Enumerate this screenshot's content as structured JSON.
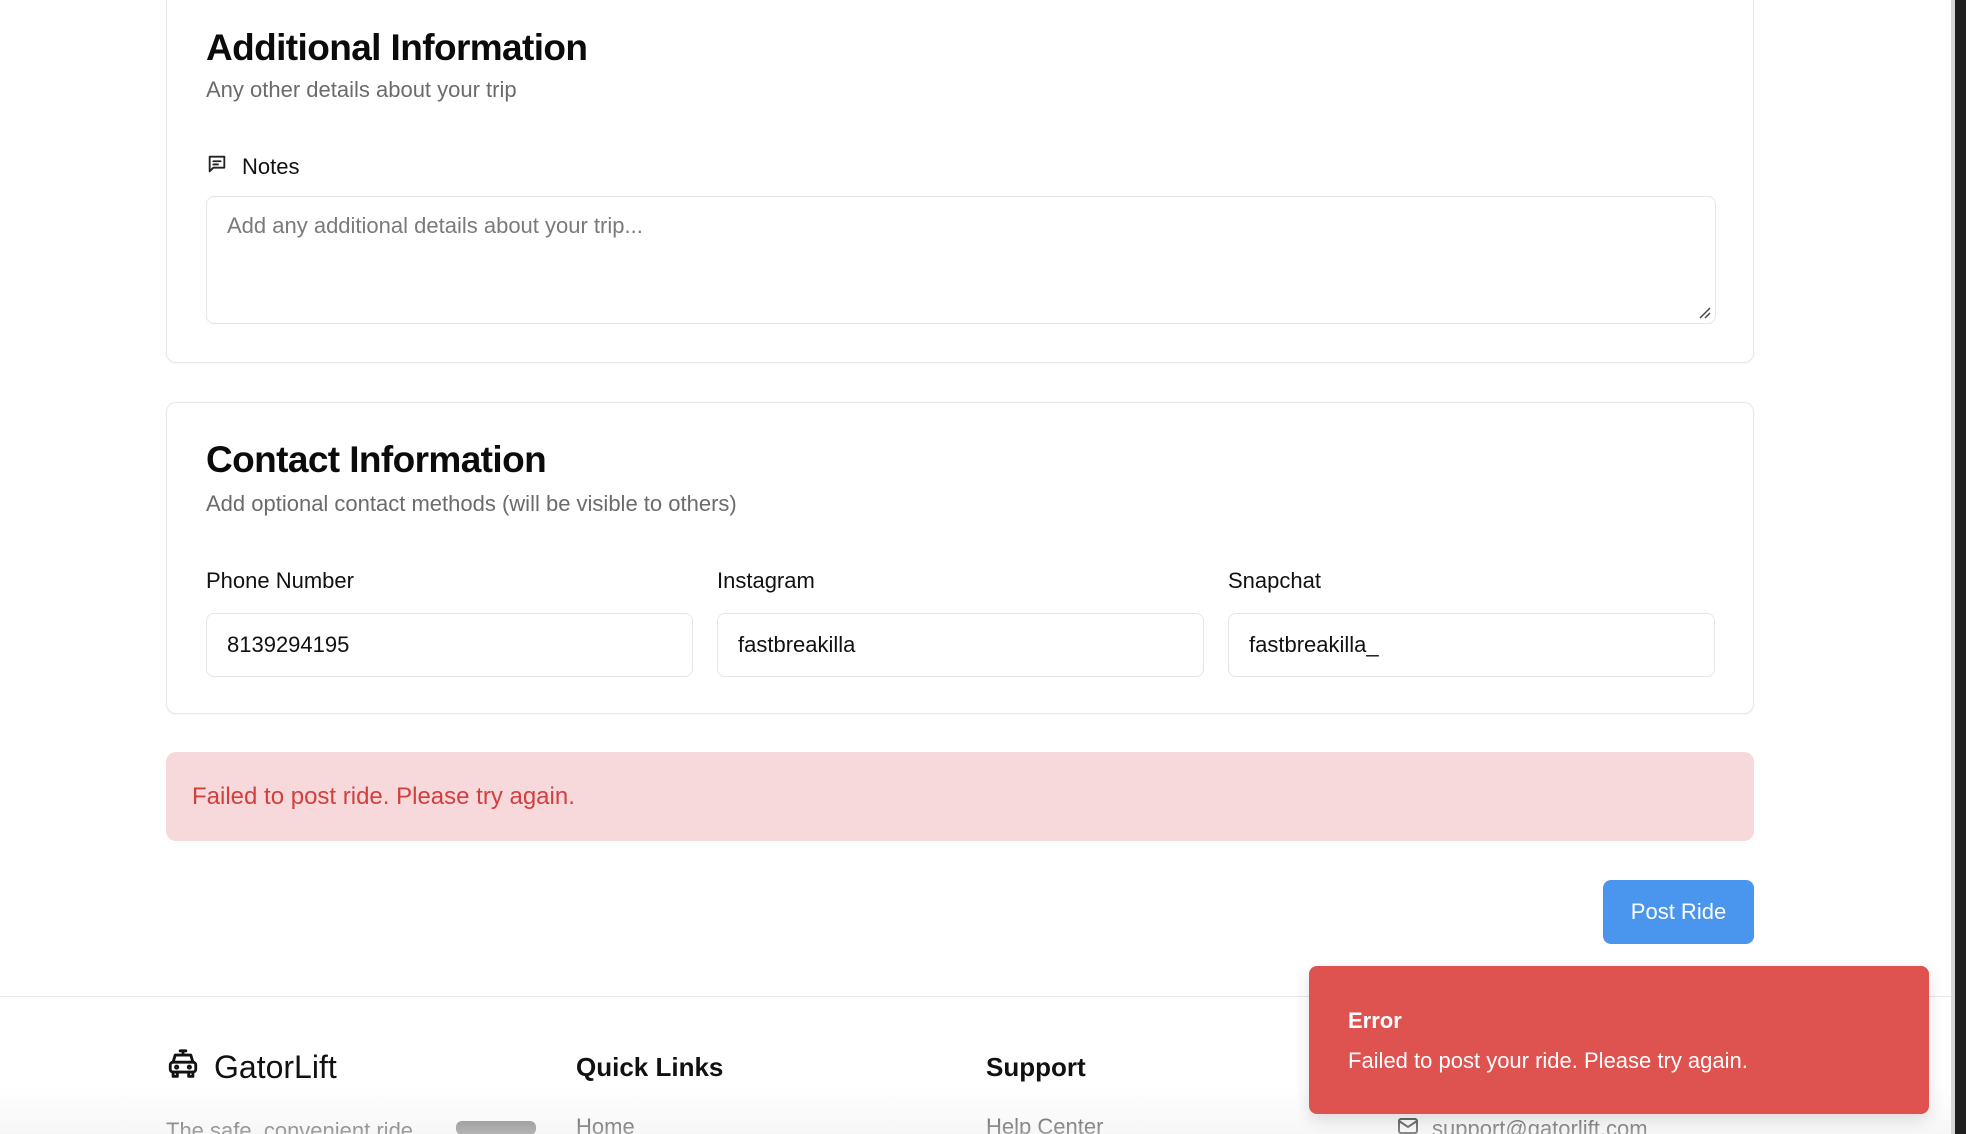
{
  "additional_info": {
    "title": "Additional Information",
    "subtitle": "Any other details about your trip",
    "notes_label": "Notes",
    "notes_placeholder": "Add any additional details about your trip...",
    "notes_value": ""
  },
  "contact_info": {
    "title": "Contact Information",
    "subtitle": "Add optional contact methods (will be visible to others)",
    "fields": [
      {
        "label": "Phone Number",
        "value": "8139294195"
      },
      {
        "label": "Instagram",
        "value": "fastbreakilla"
      },
      {
        "label": "Snapchat",
        "value": "fastbreakilla_"
      }
    ]
  },
  "error_banner": {
    "text": "Failed to post ride. Please try again.",
    "bg_color": "#f7d9db",
    "text_color": "#d23f3f"
  },
  "actions": {
    "post_ride_label": "Post Ride",
    "accent_color": "#4a96ef"
  },
  "footer": {
    "brand_name": "GatorLift",
    "brand_icon": "car-icon",
    "tagline": "The safe, convenient ride",
    "quick_links_title": "Quick Links",
    "quick_links": [
      "Home"
    ],
    "support_title": "Support",
    "support_links": [
      "Help Center"
    ],
    "contact_email": "support@gatorlift.com",
    "contact_icon": "mail-icon"
  },
  "toast": {
    "title": "Error",
    "message": "Failed to post your ride. Please try again.",
    "bg_color": "#de5250"
  }
}
